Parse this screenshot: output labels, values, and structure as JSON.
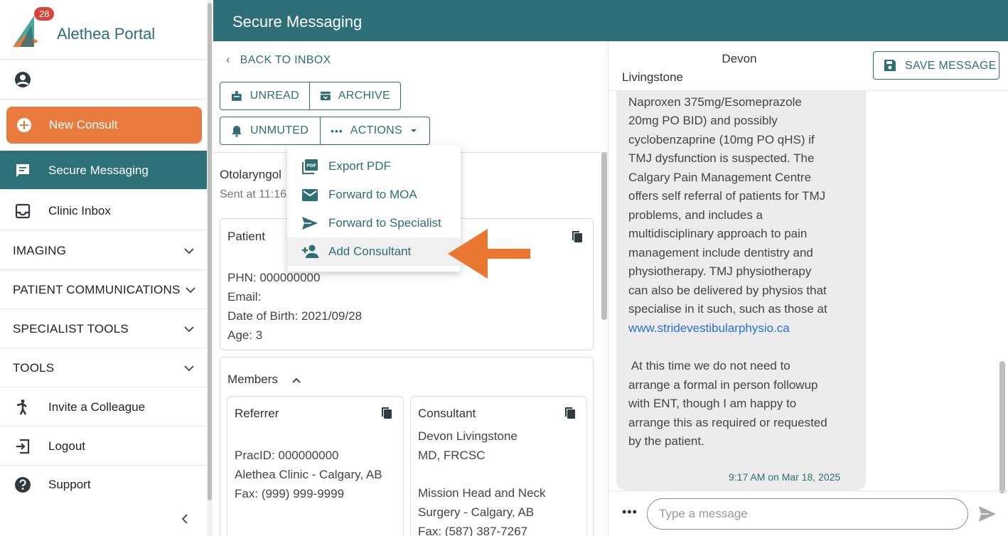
{
  "app": {
    "title": "Alethea Portal",
    "badge_count": "28"
  },
  "sidebar": {
    "new_consult": "New Consult",
    "items": [
      {
        "label": "Secure Messaging",
        "icon": "message-icon",
        "active": true
      },
      {
        "label": "Clinic Inbox",
        "icon": "inbox-icon",
        "active": false
      }
    ],
    "sections": [
      {
        "label": "IMAGING"
      },
      {
        "label": "PATIENT COMMUNICATIONS"
      },
      {
        "label": "SPECIALIST TOOLS"
      },
      {
        "label": "TOOLS"
      }
    ],
    "bottom_items": [
      {
        "label": "Invite a Colleague",
        "icon": "person-walking-icon"
      },
      {
        "label": "Logout",
        "icon": "logout-icon"
      },
      {
        "label": "Support",
        "icon": "help-icon"
      }
    ]
  },
  "header": {
    "title": "Secure Messaging"
  },
  "thread": {
    "back_label": "BACK TO INBOX",
    "buttons": {
      "unread": "UNREAD",
      "archive": "ARCHIVE",
      "unmuted": "UNMUTED",
      "actions": "ACTIONS"
    },
    "specialty": "Otolaryngol",
    "sent": "Sent at 11:16",
    "patient": {
      "title": "Patient",
      "phn": "PHN: 000000000",
      "email": "Email:",
      "dob": "Date of Birth: 2021/09/28",
      "age": "Age: 3"
    },
    "members": {
      "title": "Members",
      "referrer": {
        "title": "Referrer",
        "pracid": "PracID: 000000000",
        "clinic": "Alethea Clinic - Calgary, AB",
        "fax": "Fax: (999) 999-9999"
      },
      "consultant": {
        "title": "Consultant",
        "name": "Devon Livingstone",
        "credentials": "MD, FRCSC",
        "org_line1": "Mission Head and Neck",
        "org_line2": "Surgery - Calgary, AB",
        "fax": "Fax: (587) 387-7267"
      }
    }
  },
  "actions_menu": {
    "items": [
      {
        "label": "Export PDF",
        "icon": "pdf-icon"
      },
      {
        "label": "Forward to MOA",
        "icon": "mail-icon"
      },
      {
        "label": "Forward to Specialist",
        "icon": "send-icon"
      },
      {
        "label": "Add Consultant",
        "icon": "person-add-icon"
      }
    ]
  },
  "chat": {
    "name_line1": "Devon",
    "name_line2": "Livingstone",
    "save_label": "SAVE MESSAGE",
    "message_lines": [
      "Naproxen 375mg/Esomeprazole",
      "20mg PO BID) and possibly",
      "cyclobenzaprine (10mg PO qHS) if",
      "TMJ dysfunction is suspected. The",
      "Calgary Pain Management Centre",
      "offers self referral of patients for TMJ",
      "problems, and includes a",
      "multidisciplinary approach to pain",
      "management include dentistry and",
      "physiotherapy. TMJ physiotherapy",
      "can also be delivered by physios that",
      "specialise in it such, such as those at"
    ],
    "link": "www.stridevestibularphysio.ca",
    "message_lines_2": [
      " At this time we do not need to",
      "arrange a formal in person followup",
      "with ENT, though I am happy to",
      "arrange this as required or requested",
      "by the patient."
    ],
    "timestamp": "9:17 AM on Mar 18, 2025",
    "input_placeholder": "Type a message"
  },
  "colors": {
    "teal": "#2e6e78",
    "orange": "#e87b3d",
    "link": "#2a6fd6"
  }
}
